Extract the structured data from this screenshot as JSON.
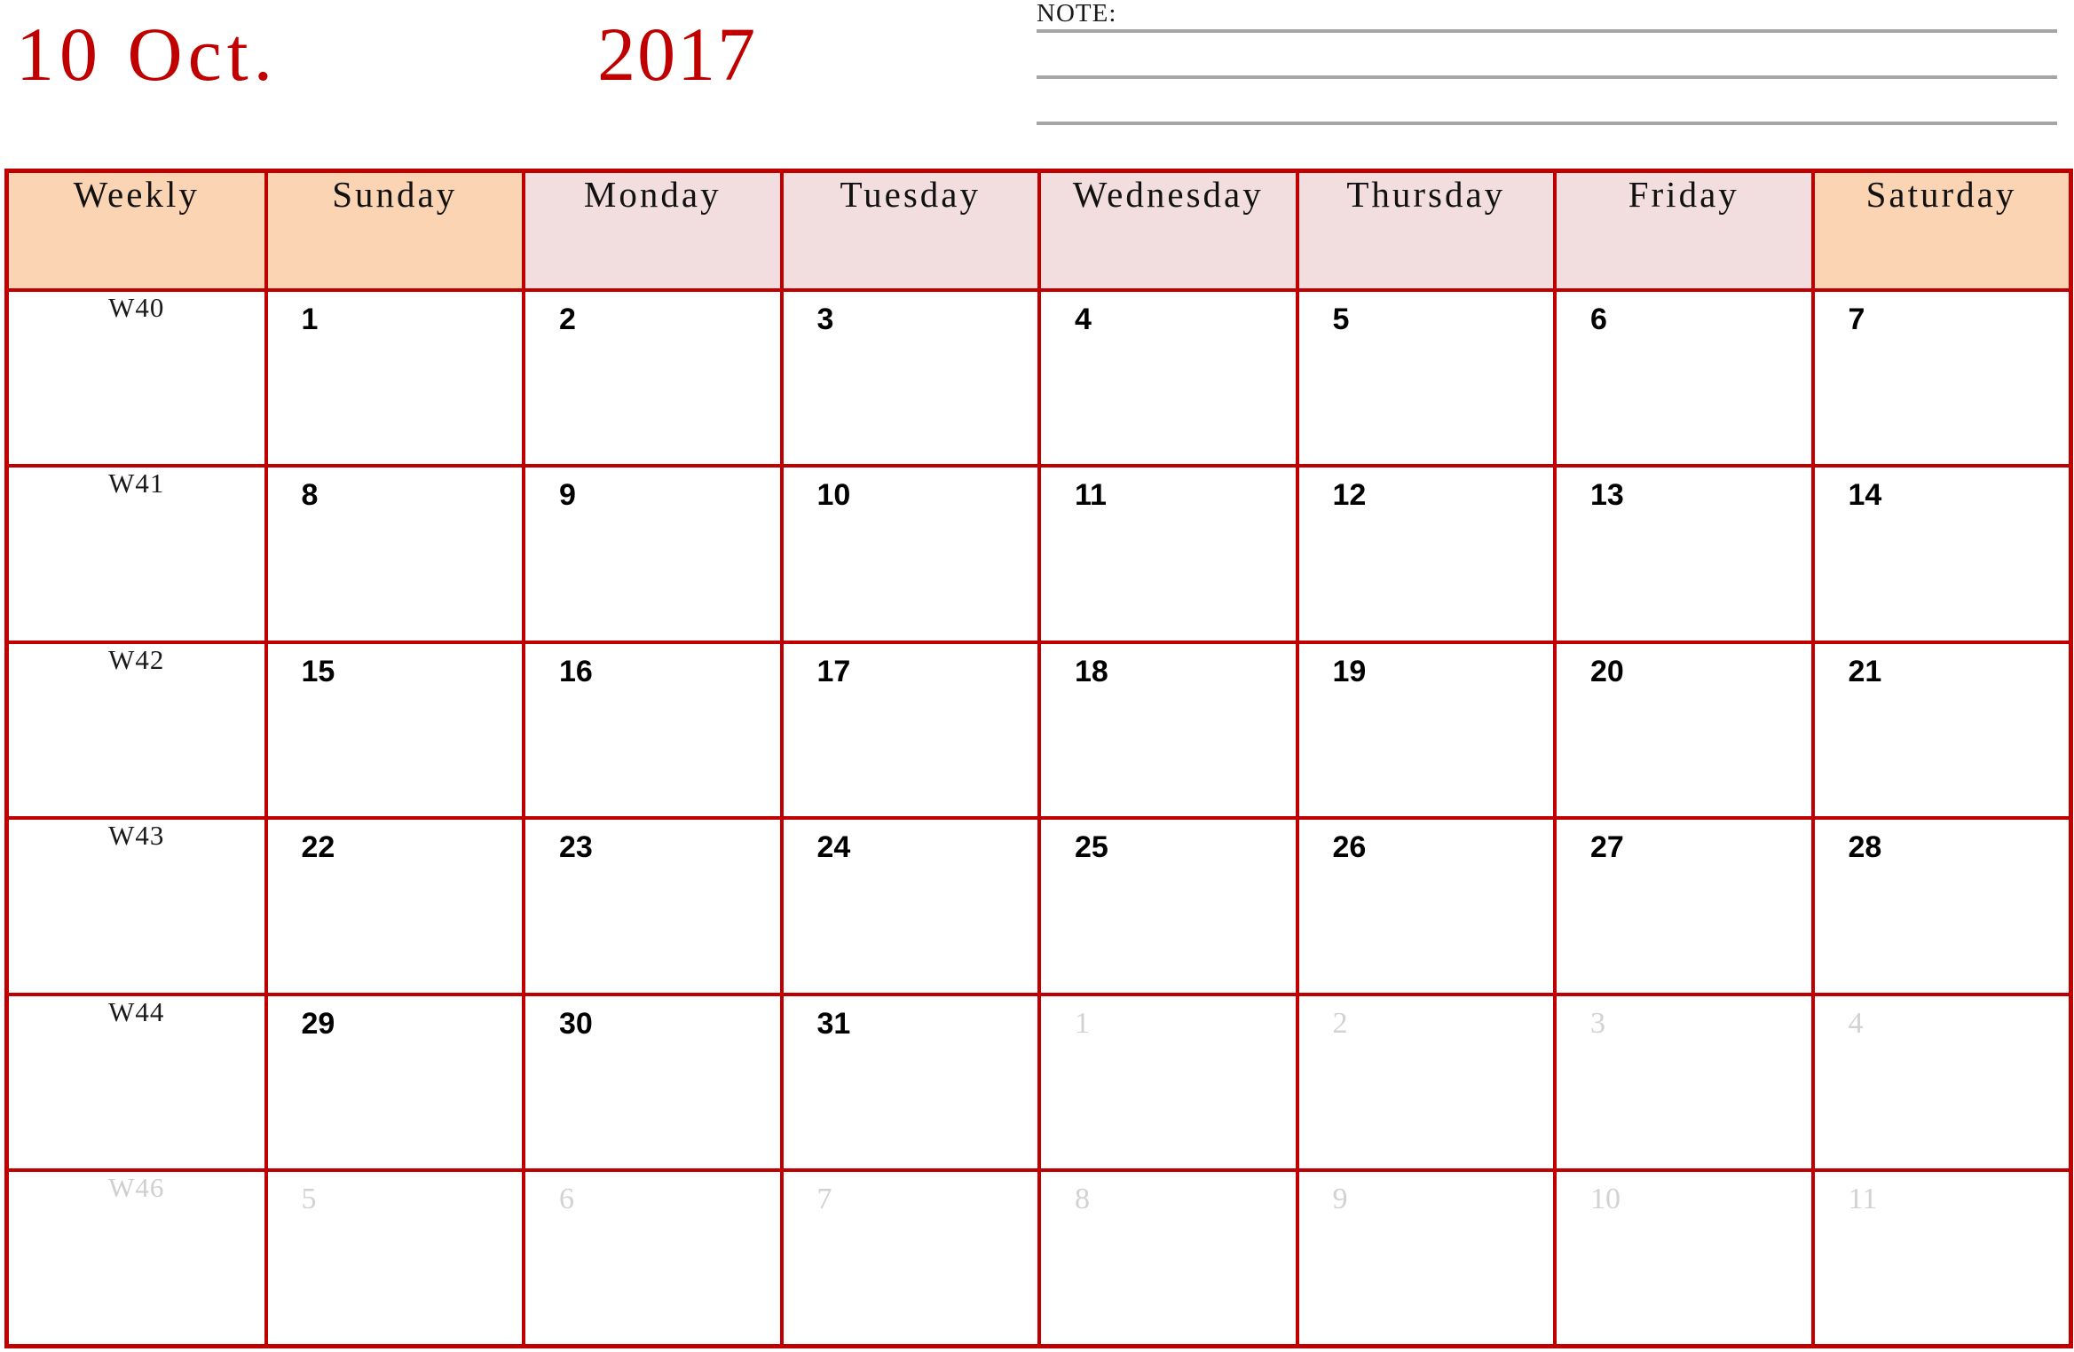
{
  "title": {
    "month": "10 Oct.",
    "year": "2017"
  },
  "note": {
    "label": "NOTE:",
    "lines": 3
  },
  "table": {
    "headers": [
      {
        "label": "Weekly",
        "style": "weekend"
      },
      {
        "label": "Sunday",
        "style": "weekend"
      },
      {
        "label": "Monday",
        "style": "weekday"
      },
      {
        "label": "Tuesday",
        "style": "weekday"
      },
      {
        "label": "Wednesday",
        "style": "weekday"
      },
      {
        "label": "Thursday",
        "style": "weekday"
      },
      {
        "label": "Friday",
        "style": "weekday"
      },
      {
        "label": "Saturday",
        "style": "weekend"
      }
    ],
    "rows": [
      {
        "week": "W40",
        "week_muted": false,
        "days": [
          {
            "num": "1",
            "current": true
          },
          {
            "num": "2",
            "current": true
          },
          {
            "num": "3",
            "current": true
          },
          {
            "num": "4",
            "current": true
          },
          {
            "num": "5",
            "current": true
          },
          {
            "num": "6",
            "current": true
          },
          {
            "num": "7",
            "current": true
          }
        ]
      },
      {
        "week": "W41",
        "week_muted": false,
        "days": [
          {
            "num": "8",
            "current": true
          },
          {
            "num": "9",
            "current": true
          },
          {
            "num": "10",
            "current": true
          },
          {
            "num": "11",
            "current": true
          },
          {
            "num": "12",
            "current": true
          },
          {
            "num": "13",
            "current": true
          },
          {
            "num": "14",
            "current": true
          }
        ]
      },
      {
        "week": "W42",
        "week_muted": false,
        "days": [
          {
            "num": "15",
            "current": true
          },
          {
            "num": "16",
            "current": true
          },
          {
            "num": "17",
            "current": true
          },
          {
            "num": "18",
            "current": true
          },
          {
            "num": "19",
            "current": true
          },
          {
            "num": "20",
            "current": true
          },
          {
            "num": "21",
            "current": true
          }
        ]
      },
      {
        "week": "W43",
        "week_muted": false,
        "days": [
          {
            "num": "22",
            "current": true
          },
          {
            "num": "23",
            "current": true
          },
          {
            "num": "24",
            "current": true
          },
          {
            "num": "25",
            "current": true
          },
          {
            "num": "26",
            "current": true
          },
          {
            "num": "27",
            "current": true
          },
          {
            "num": "28",
            "current": true
          }
        ]
      },
      {
        "week": "W44",
        "week_muted": false,
        "days": [
          {
            "num": "29",
            "current": true
          },
          {
            "num": "30",
            "current": true
          },
          {
            "num": "31",
            "current": true
          },
          {
            "num": "1",
            "current": false
          },
          {
            "num": "2",
            "current": false
          },
          {
            "num": "3",
            "current": false
          },
          {
            "num": "4",
            "current": false
          }
        ]
      },
      {
        "week": "W46",
        "week_muted": true,
        "days": [
          {
            "num": "5",
            "current": false
          },
          {
            "num": "6",
            "current": false
          },
          {
            "num": "7",
            "current": false
          },
          {
            "num": "8",
            "current": false
          },
          {
            "num": "9",
            "current": false
          },
          {
            "num": "10",
            "current": false
          },
          {
            "num": "11",
            "current": false
          }
        ]
      }
    ]
  },
  "colors": {
    "accent_red": "#C00000",
    "header_weekend_bg": "#FBD4B4",
    "header_weekday_bg": "#F2DEDE",
    "note_rule": "#A6A6A6",
    "other_month_text": "#D2D2D2"
  }
}
